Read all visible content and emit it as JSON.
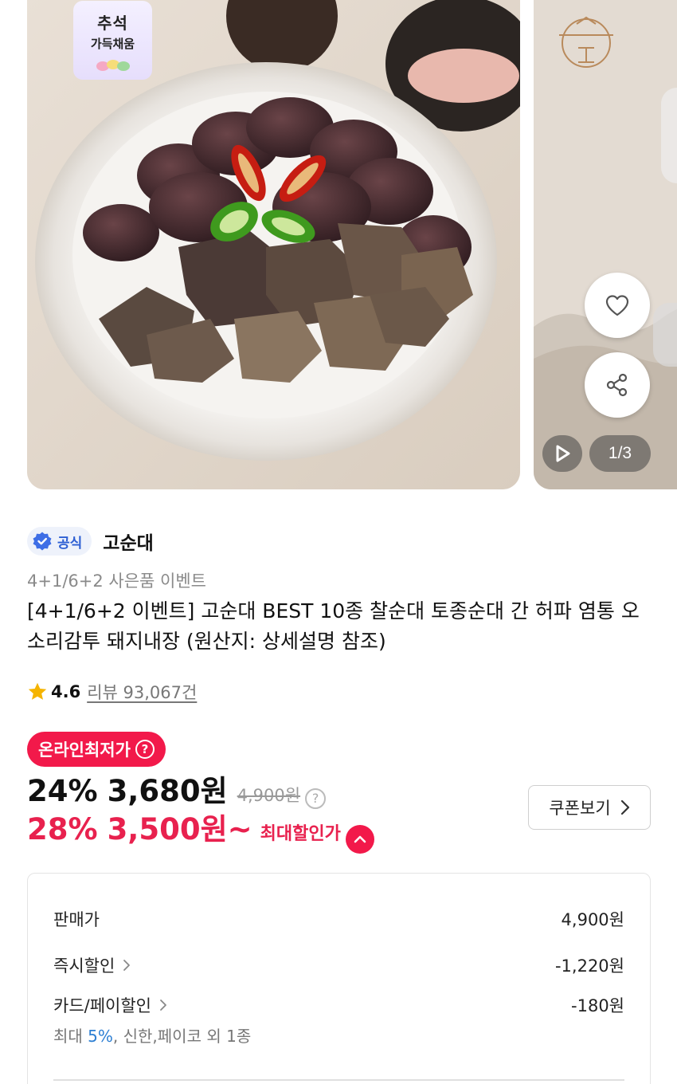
{
  "carousel": {
    "promo_badge_line1": "추석",
    "promo_badge_line2": "가득채움",
    "page_indicator": "1/3"
  },
  "brand": {
    "official_label": "공식",
    "name": "고순대"
  },
  "product": {
    "subtitle": "4+1/6+2 사은품 이벤트",
    "title": "[4+1/6+2 이벤트] 고순대 BEST 10종 찰순대 토종순대 간 허파 염통 오소리감투 돼지내장 (원산지: 상세설명 참조)",
    "rating": "4.6",
    "reviews": "리뷰 93,067건"
  },
  "pricing": {
    "lowest_badge": "온라인최저가",
    "discount_pct": "24%",
    "price": "3,680원",
    "original_price": "4,900원",
    "max_discount_pct": "28%",
    "max_price": "3,500원~",
    "max_label": "최대할인가",
    "coupon_button": "쿠폰보기"
  },
  "breakdown": {
    "sale_price_label": "판매가",
    "sale_price_value": "4,900원",
    "instant_discount_label": "즉시할인",
    "instant_discount_value": "-1,220원",
    "card_discount_label": "카드/페이할인",
    "card_discount_value": "-180원",
    "card_note_prefix": "최대",
    "card_note_pct": "5%",
    "card_note_suffix": ", 신한,페이코 외 1종"
  },
  "colors": {
    "accent_red": "#f2194a",
    "price_red": "#e8214e",
    "official_blue": "#2d5fd3",
    "star": "#f5b400"
  },
  "icons": [
    "heart-icon",
    "share-icon",
    "play-icon",
    "verified-icon",
    "star-icon",
    "help-icon",
    "chevron-up-icon",
    "chevron-right-icon"
  ]
}
